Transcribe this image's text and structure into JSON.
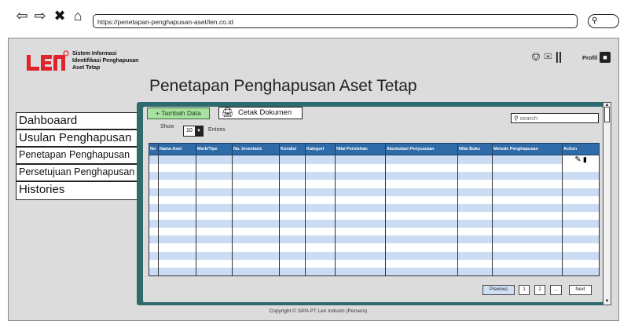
{
  "browser": {
    "back_icon": "⇦",
    "forward_icon": "⇨",
    "close_icon": "✖",
    "home_icon": "⌂",
    "url": "https://penetapan-penghapusan-aset/len.co.id",
    "search_icon": "🔍"
  },
  "header": {
    "logo_text": "LEN",
    "app_name_line1": "Sistem Informasi",
    "app_name_line2": "Identifikasi Penghapusan",
    "app_name_line3": "Aset Tetap",
    "bell_icon": "🔔",
    "mail_icon": "✉",
    "divider_icon": "||",
    "profile_label": "Profil"
  },
  "page_title": "Penetapan Penghapusan Aset Tetap",
  "sidebar": {
    "items": [
      {
        "label": "Dahboaard"
      },
      {
        "label": "Usulan Penghapusan"
      },
      {
        "label": "Penetapan Penghapusan"
      },
      {
        "label": "Persetujuan Penghapusan"
      },
      {
        "label": "Histories"
      }
    ]
  },
  "toolbar": {
    "add_label": "+ Tambah Data",
    "print_label": "Cetak Dokumen",
    "print_icon": "🖨",
    "show_label": "Show",
    "show_value": "10",
    "entries_label": "Entries",
    "search_placeholder": "search"
  },
  "table": {
    "columns": [
      "No",
      "Nama Aset",
      "Merk/Tipe",
      "No. Inventaris",
      "Kondisi",
      "Kategori",
      "Nilai Perolehan",
      "Akumulasi Penyusutan",
      "Nilai Buku",
      "Metode Penghapusan",
      "Action"
    ],
    "edit_icon": "✎",
    "delete_icon": "🗑"
  },
  "pagination": {
    "previous": "Previous",
    "page1": "1",
    "page2": "2",
    "ellipsis": "...",
    "next": "Next"
  },
  "footer": {
    "copyright": "Copyright © SIPA PT Len Industri (Persero)"
  },
  "colors": {
    "accent": "#2f6a6e",
    "table_header": "#2f6ba8",
    "row_stripe": "#c9dcf3",
    "add_button": "#a8e1a0",
    "logo_red": "#e0242b"
  }
}
